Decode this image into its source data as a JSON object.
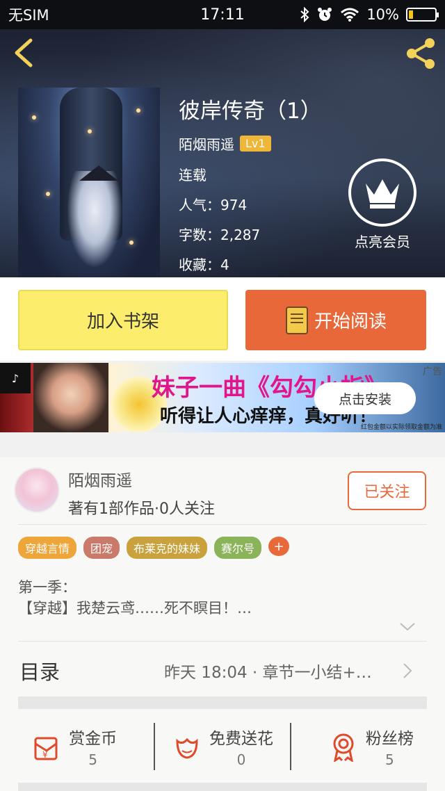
{
  "status_bar": {
    "carrier": "无SIM",
    "time": "17:11",
    "battery": "10%"
  },
  "book": {
    "title": "彼岸传奇（1）",
    "author": "陌烟雨遥",
    "level": "Lv1",
    "status": "连载",
    "popularity": "人气：974",
    "word_count": "字数：2,287",
    "favorites": "收藏：4"
  },
  "vip": {
    "label": "点亮会员"
  },
  "actions": {
    "add_shelf": "加入书架",
    "start_read": "开始阅读"
  },
  "ad": {
    "line1": "妹子一曲《勾勾小指》",
    "line2": "听得让人心痒痒，真好听！",
    "install": "点击安装",
    "tag": "广告",
    "disclaimer": "红包金额以实际领取金额为准"
  },
  "author_card": {
    "name": "陌烟雨遥",
    "stats": "著有1部作品·0人关注",
    "follow": "已关注",
    "tags": [
      {
        "label": "穿越言情",
        "color": "#eea53a"
      },
      {
        "label": "团宠",
        "color": "#c97a6a"
      },
      {
        "label": "布莱克的妹妹",
        "color": "#c9a23e"
      },
      {
        "label": "赛尔号",
        "color": "#8ab35a"
      }
    ],
    "tag_add": "+",
    "desc_line1": "第一季：",
    "desc_line2": "【穿越】我楚云鸢……死不瞑目！…"
  },
  "toc": {
    "label": "目录",
    "latest": "昨天 18:04 · 章节一小结+…"
  },
  "stats": [
    {
      "label": "赏金币",
      "value": "5"
    },
    {
      "label": "免费送花",
      "value": "0"
    },
    {
      "label": "粉丝榜",
      "value": "5"
    }
  ],
  "colors": {
    "accent": "#e8683a",
    "shelf_button": "#fcee6c",
    "level_badge": "#f0b638"
  }
}
